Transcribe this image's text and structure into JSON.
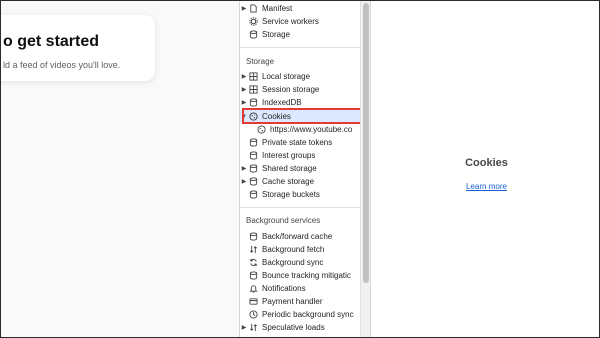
{
  "page": {
    "heading": "o get started",
    "subtext": "ld a feed of videos you'll love."
  },
  "sidebar": {
    "top_items": [
      {
        "label": "Manifest",
        "icon": "document-icon",
        "arrow": true
      },
      {
        "label": "Service workers",
        "icon": "gear-icon",
        "arrow": false
      },
      {
        "label": "Storage",
        "icon": "database-icon",
        "arrow": false
      }
    ],
    "storage_section": {
      "title": "Storage",
      "items": [
        {
          "label": "Local storage",
          "icon": "grid-icon",
          "arrow": true
        },
        {
          "label": "Session storage",
          "icon": "grid-icon",
          "arrow": true
        },
        {
          "label": "IndexedDB",
          "icon": "database-icon",
          "arrow": true
        },
        {
          "label": "Cookies",
          "icon": "cookie-icon",
          "arrow": true,
          "expanded": true,
          "selected": true
        },
        {
          "label": "https://www.youtube.co",
          "icon": "cookie-icon",
          "arrow": false,
          "child": true
        },
        {
          "label": "Private state tokens",
          "icon": "database-icon",
          "arrow": false
        },
        {
          "label": "Interest groups",
          "icon": "database-icon",
          "arrow": false
        },
        {
          "label": "Shared storage",
          "icon": "database-icon",
          "arrow": true
        },
        {
          "label": "Cache storage",
          "icon": "database-icon",
          "arrow": true
        },
        {
          "label": "Storage buckets",
          "icon": "database-icon",
          "arrow": false
        }
      ]
    },
    "background_section": {
      "title": "Background services",
      "items": [
        {
          "label": "Back/forward cache",
          "icon": "database-icon",
          "arrow": false
        },
        {
          "label": "Background fetch",
          "icon": "fetch-icon",
          "arrow": false
        },
        {
          "label": "Background sync",
          "icon": "sync-icon",
          "arrow": false
        },
        {
          "label": "Bounce tracking mitigatic",
          "icon": "database-icon",
          "arrow": false
        },
        {
          "label": "Notifications",
          "icon": "bell-icon",
          "arrow": false
        },
        {
          "label": "Payment handler",
          "icon": "card-icon",
          "arrow": false
        },
        {
          "label": "Periodic background sync",
          "icon": "clock-icon",
          "arrow": false
        },
        {
          "label": "Speculative loads",
          "icon": "fetch-icon",
          "arrow": true
        }
      ]
    }
  },
  "pane": {
    "title": "Cookies",
    "link": "Learn more"
  },
  "colors": {
    "selected_bg": "#dbe8fd",
    "highlight_border": "#e53935",
    "link": "#1a5fd6"
  }
}
